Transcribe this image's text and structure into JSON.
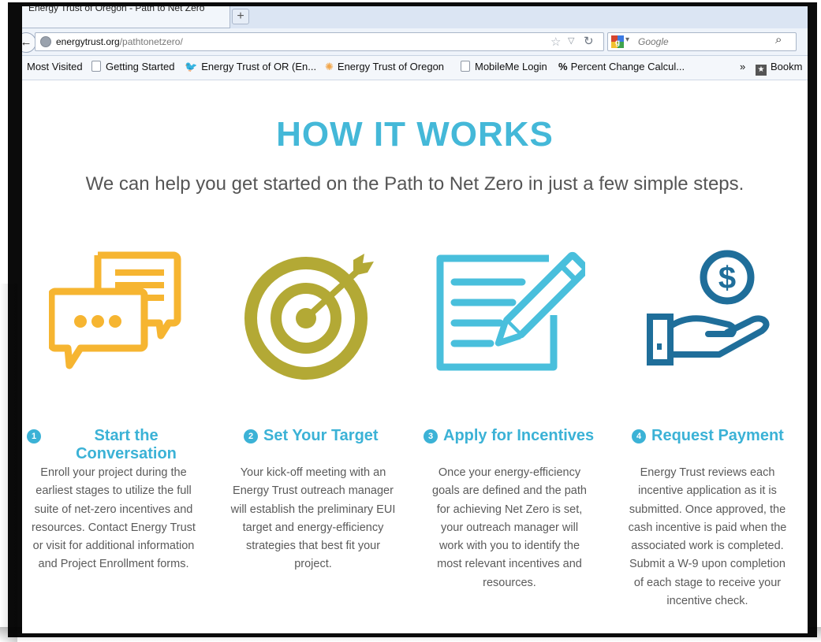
{
  "browser": {
    "tab_title": "Energy Trust of Oregon - Path to Net Zero",
    "new_tab_label": "+",
    "back_label": "←",
    "url_domain": "energytrust.org",
    "url_path": "/pathtonetzero/",
    "search_placeholder": "Google",
    "bookmarks": [
      {
        "label": "Most Visited",
        "icon": "none"
      },
      {
        "label": "Getting Started",
        "icon": "page-icon"
      },
      {
        "label": "Energy Trust of OR (En...",
        "icon": "twitter-bird-icon"
      },
      {
        "label": "Energy Trust of Oregon",
        "icon": "sunburst-icon"
      },
      {
        "label": "MobileMe Login",
        "icon": "page-icon"
      },
      {
        "label": "Percent Change Calcul...",
        "icon": "percent-icon"
      },
      {
        "label": "»",
        "icon": "none"
      },
      {
        "label": "Bookm",
        "icon": "bookmarks-icon"
      }
    ]
  },
  "page": {
    "heading": "HOW IT WORKS",
    "subheading": "We can help you get started on the Path to Net Zero in just a few simple steps."
  },
  "steps": [
    {
      "number": "1",
      "title": "Start the Conversation",
      "icon": "speech-bubbles-icon",
      "color": "#f6b531",
      "description": "Enroll your project during the earliest stages to utilize the full suite of net-zero incentives and resources. Contact Energy Trust or visit for additional information and Project Enrollment forms."
    },
    {
      "number": "2",
      "title": "Set Your Target",
      "icon": "target-arrow-icon",
      "color": "#b3a935",
      "description": "Your kick-off meeting with an Energy Trust outreach manager will establish the preliminary EUI target and energy-efficiency strategies that best fit your project."
    },
    {
      "number": "3",
      "title": "Apply for Incentives",
      "icon": "form-pencil-icon",
      "color": "#49bfdc",
      "description": "Once your energy-efficiency goals are defined and the path for achieving Net Zero is set, your outreach manager will work with you to identify the most relevant incentives and resources."
    },
    {
      "number": "4",
      "title": "Request Payment",
      "icon": "hand-dollar-icon",
      "color": "#1f6e9a",
      "description": "Energy Trust reviews each incentive application as it is submitted. Once approved, the cash incentive is paid when the associated work is completed. Submit a W-9 upon completion of each stage to receive your incentive check."
    }
  ],
  "colors": {
    "accent": "#3bb2d6",
    "heading": "#44b8d8",
    "body_text": "#5a5a5a"
  }
}
